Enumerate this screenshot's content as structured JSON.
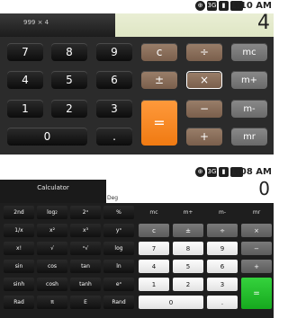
{
  "screen1": {
    "status_time": "1:10 AM",
    "formula": "999 × 4",
    "result": "4",
    "keys": {
      "k7": "7",
      "k8": "8",
      "k9": "9",
      "k4": "4",
      "k5": "5",
      "k6": "6",
      "k1": "1",
      "k2": "2",
      "k3": "3",
      "k0": "0",
      "dot": ".",
      "clear": "c",
      "divide": "÷",
      "plusminus": "±",
      "multiply": "×",
      "minus": "−",
      "plus": "+",
      "equals": "=",
      "mc": "mc",
      "mplus": "m+",
      "mminus": "m-",
      "mr": "mr"
    }
  },
  "screen2": {
    "status_time": "1:08 AM",
    "title": "Calculator",
    "mode": "Deg",
    "result": "0",
    "sci": {
      "r1": [
        "2nd",
        "log",
        "2ˣ",
        "%"
      ],
      "r2": [
        "1/x",
        "x²",
        "x³",
        "yˣ"
      ],
      "r3": [
        "x!",
        "√",
        "ˣ√",
        "log"
      ],
      "r4": [
        "sin",
        "cos",
        "tan",
        "ln"
      ],
      "r5": [
        "sinh",
        "cosh",
        "tanh",
        "eˣ"
      ],
      "r6": [
        "Rad",
        "π",
        "E",
        "Rand"
      ]
    },
    "mem": [
      "mc",
      "m+",
      "m-",
      "mr"
    ],
    "ops": [
      "c",
      "±",
      "÷",
      "×"
    ],
    "pad": {
      "r1": [
        "7",
        "8",
        "9",
        "−"
      ],
      "r2": [
        "4",
        "5",
        "6",
        "+"
      ],
      "r3": [
        "1",
        "2",
        "3"
      ],
      "r4": [
        "0",
        "."
      ],
      "equals": "="
    }
  },
  "colors": {
    "equals_orange": "#f07a12",
    "equals_green": "#16a91e",
    "display_tint": "#e9eed4"
  }
}
